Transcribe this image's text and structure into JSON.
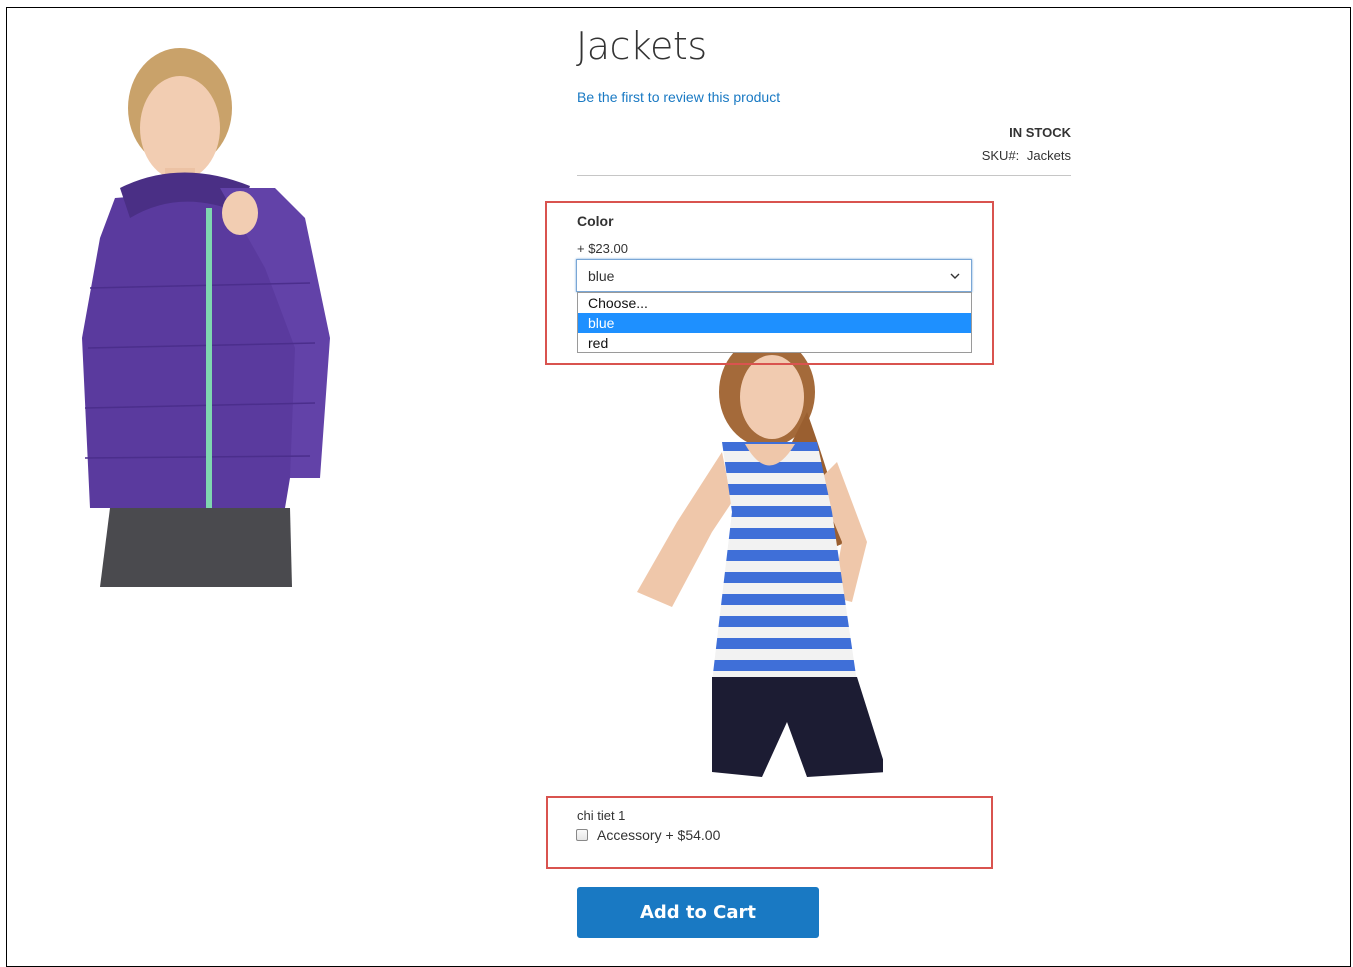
{
  "product": {
    "title": "Jackets",
    "review_link": "Be the first to review this product",
    "stock_status": "In stock",
    "sku_label": "SKU#:",
    "sku_value": "Jackets"
  },
  "options": {
    "color": {
      "label": "Color",
      "price": "+ $23.00",
      "selected": "blue",
      "dropdown": [
        "Choose...",
        "blue",
        "red"
      ]
    },
    "accessory": {
      "title": "chi tiet 1",
      "label": "Accessory",
      "price": "+ $54.00"
    }
  },
  "actions": {
    "add_to_cart": "Add to Cart"
  },
  "images": {
    "main_photo": "woman-purple-jacket",
    "option_photo": "woman-striped-tank"
  },
  "colors": {
    "link": "#1979c3",
    "primary_button": "#1979c3",
    "dropdown_highlight": "#1e90ff",
    "annotation_border": "#d9534f"
  }
}
